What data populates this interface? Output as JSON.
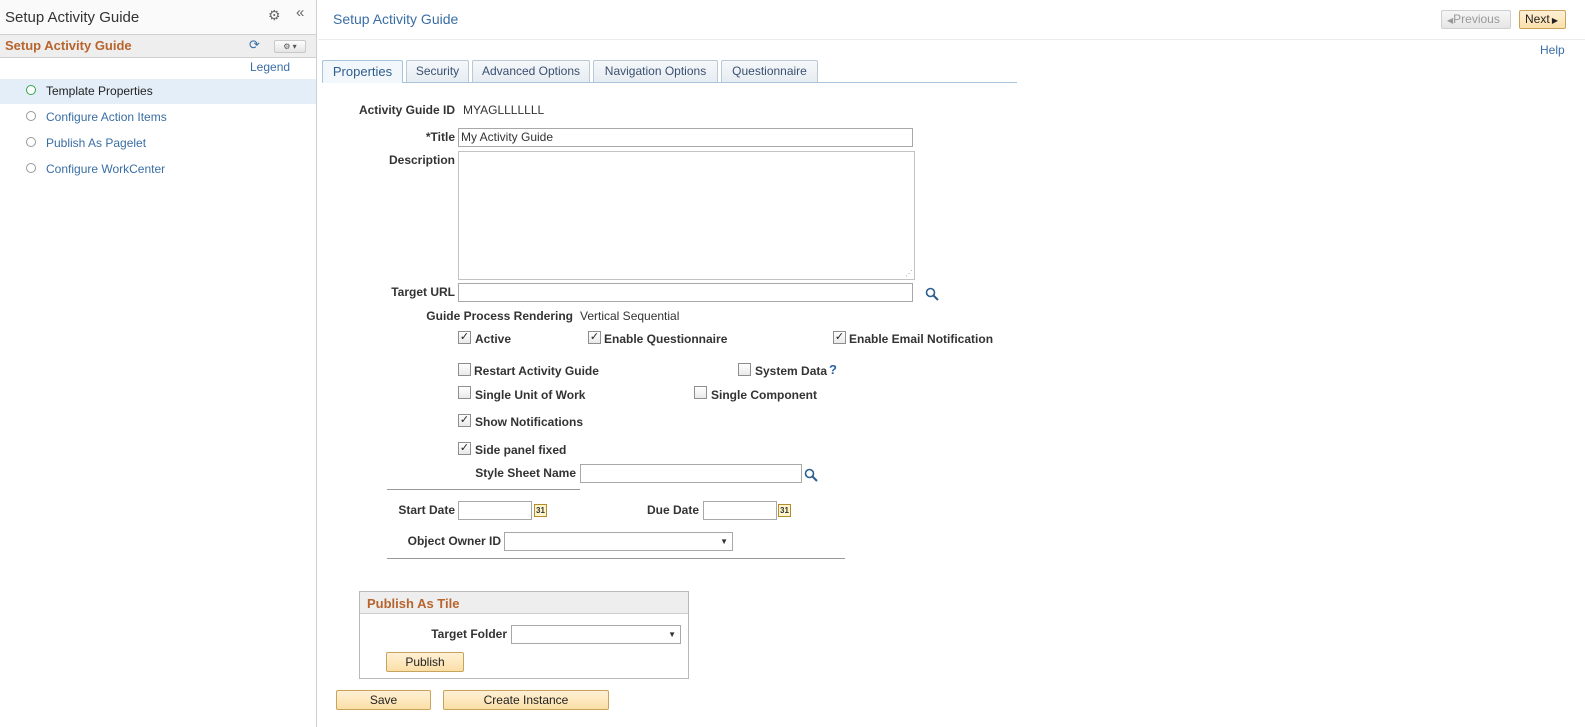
{
  "sidebar": {
    "window_title": "Setup Activity Guide",
    "header_title": "Setup Activity Guide",
    "legend_label": "Legend",
    "items": [
      {
        "label": "Template Properties"
      },
      {
        "label": "Configure Action Items"
      },
      {
        "label": "Publish As Pagelet"
      },
      {
        "label": "Configure WorkCenter"
      }
    ]
  },
  "header": {
    "title": "Setup Activity Guide",
    "previous_label": "Previous",
    "next_label": "Next",
    "help_label": "Help"
  },
  "tabs": [
    {
      "label": "Properties",
      "active": true
    },
    {
      "label": "Security"
    },
    {
      "label": "Advanced Options"
    },
    {
      "label": "Navigation Options"
    },
    {
      "label": "Questionnaire"
    }
  ],
  "form": {
    "guide_id_label": "Activity Guide ID",
    "guide_id_value": "MYAGLLLLLLL",
    "title_label": "*Title",
    "title_value": "My Activity Guide",
    "description_label": "Description",
    "target_url_label": "Target URL",
    "rendering_label": "Guide Process Rendering",
    "rendering_value": "Vertical Sequential",
    "checkboxes": {
      "active": {
        "label": "Active",
        "checked": true
      },
      "enable_questionnaire": {
        "label": "Enable Questionnaire",
        "checked": true
      },
      "enable_email": {
        "label": "Enable Email Notification",
        "checked": true
      },
      "restart": {
        "label": "Restart Activity Guide",
        "checked": false
      },
      "system_data": {
        "label": "System Data",
        "checked": false
      },
      "single_uow": {
        "label": "Single Unit of Work",
        "checked": false
      },
      "single_component": {
        "label": "Single Component",
        "checked": false
      },
      "show_notifications": {
        "label": "Show Notifications",
        "checked": true
      },
      "side_panel": {
        "label": "Side panel fixed",
        "checked": true
      }
    },
    "style_sheet_label": "Style Sheet Name",
    "start_date_label": "Start Date",
    "due_date_label": "Due Date",
    "owner_label": "Object Owner ID"
  },
  "tile": {
    "title": "Publish As Tile",
    "target_folder_label": "Target Folder",
    "publish_label": "Publish"
  },
  "buttons": {
    "save": "Save",
    "create_instance": "Create Instance"
  },
  "colors": {
    "accent": "#b8642d",
    "link": "#3a6ea5",
    "selected_row": "#e4eef8",
    "button_bg": "#fbe0aa"
  }
}
